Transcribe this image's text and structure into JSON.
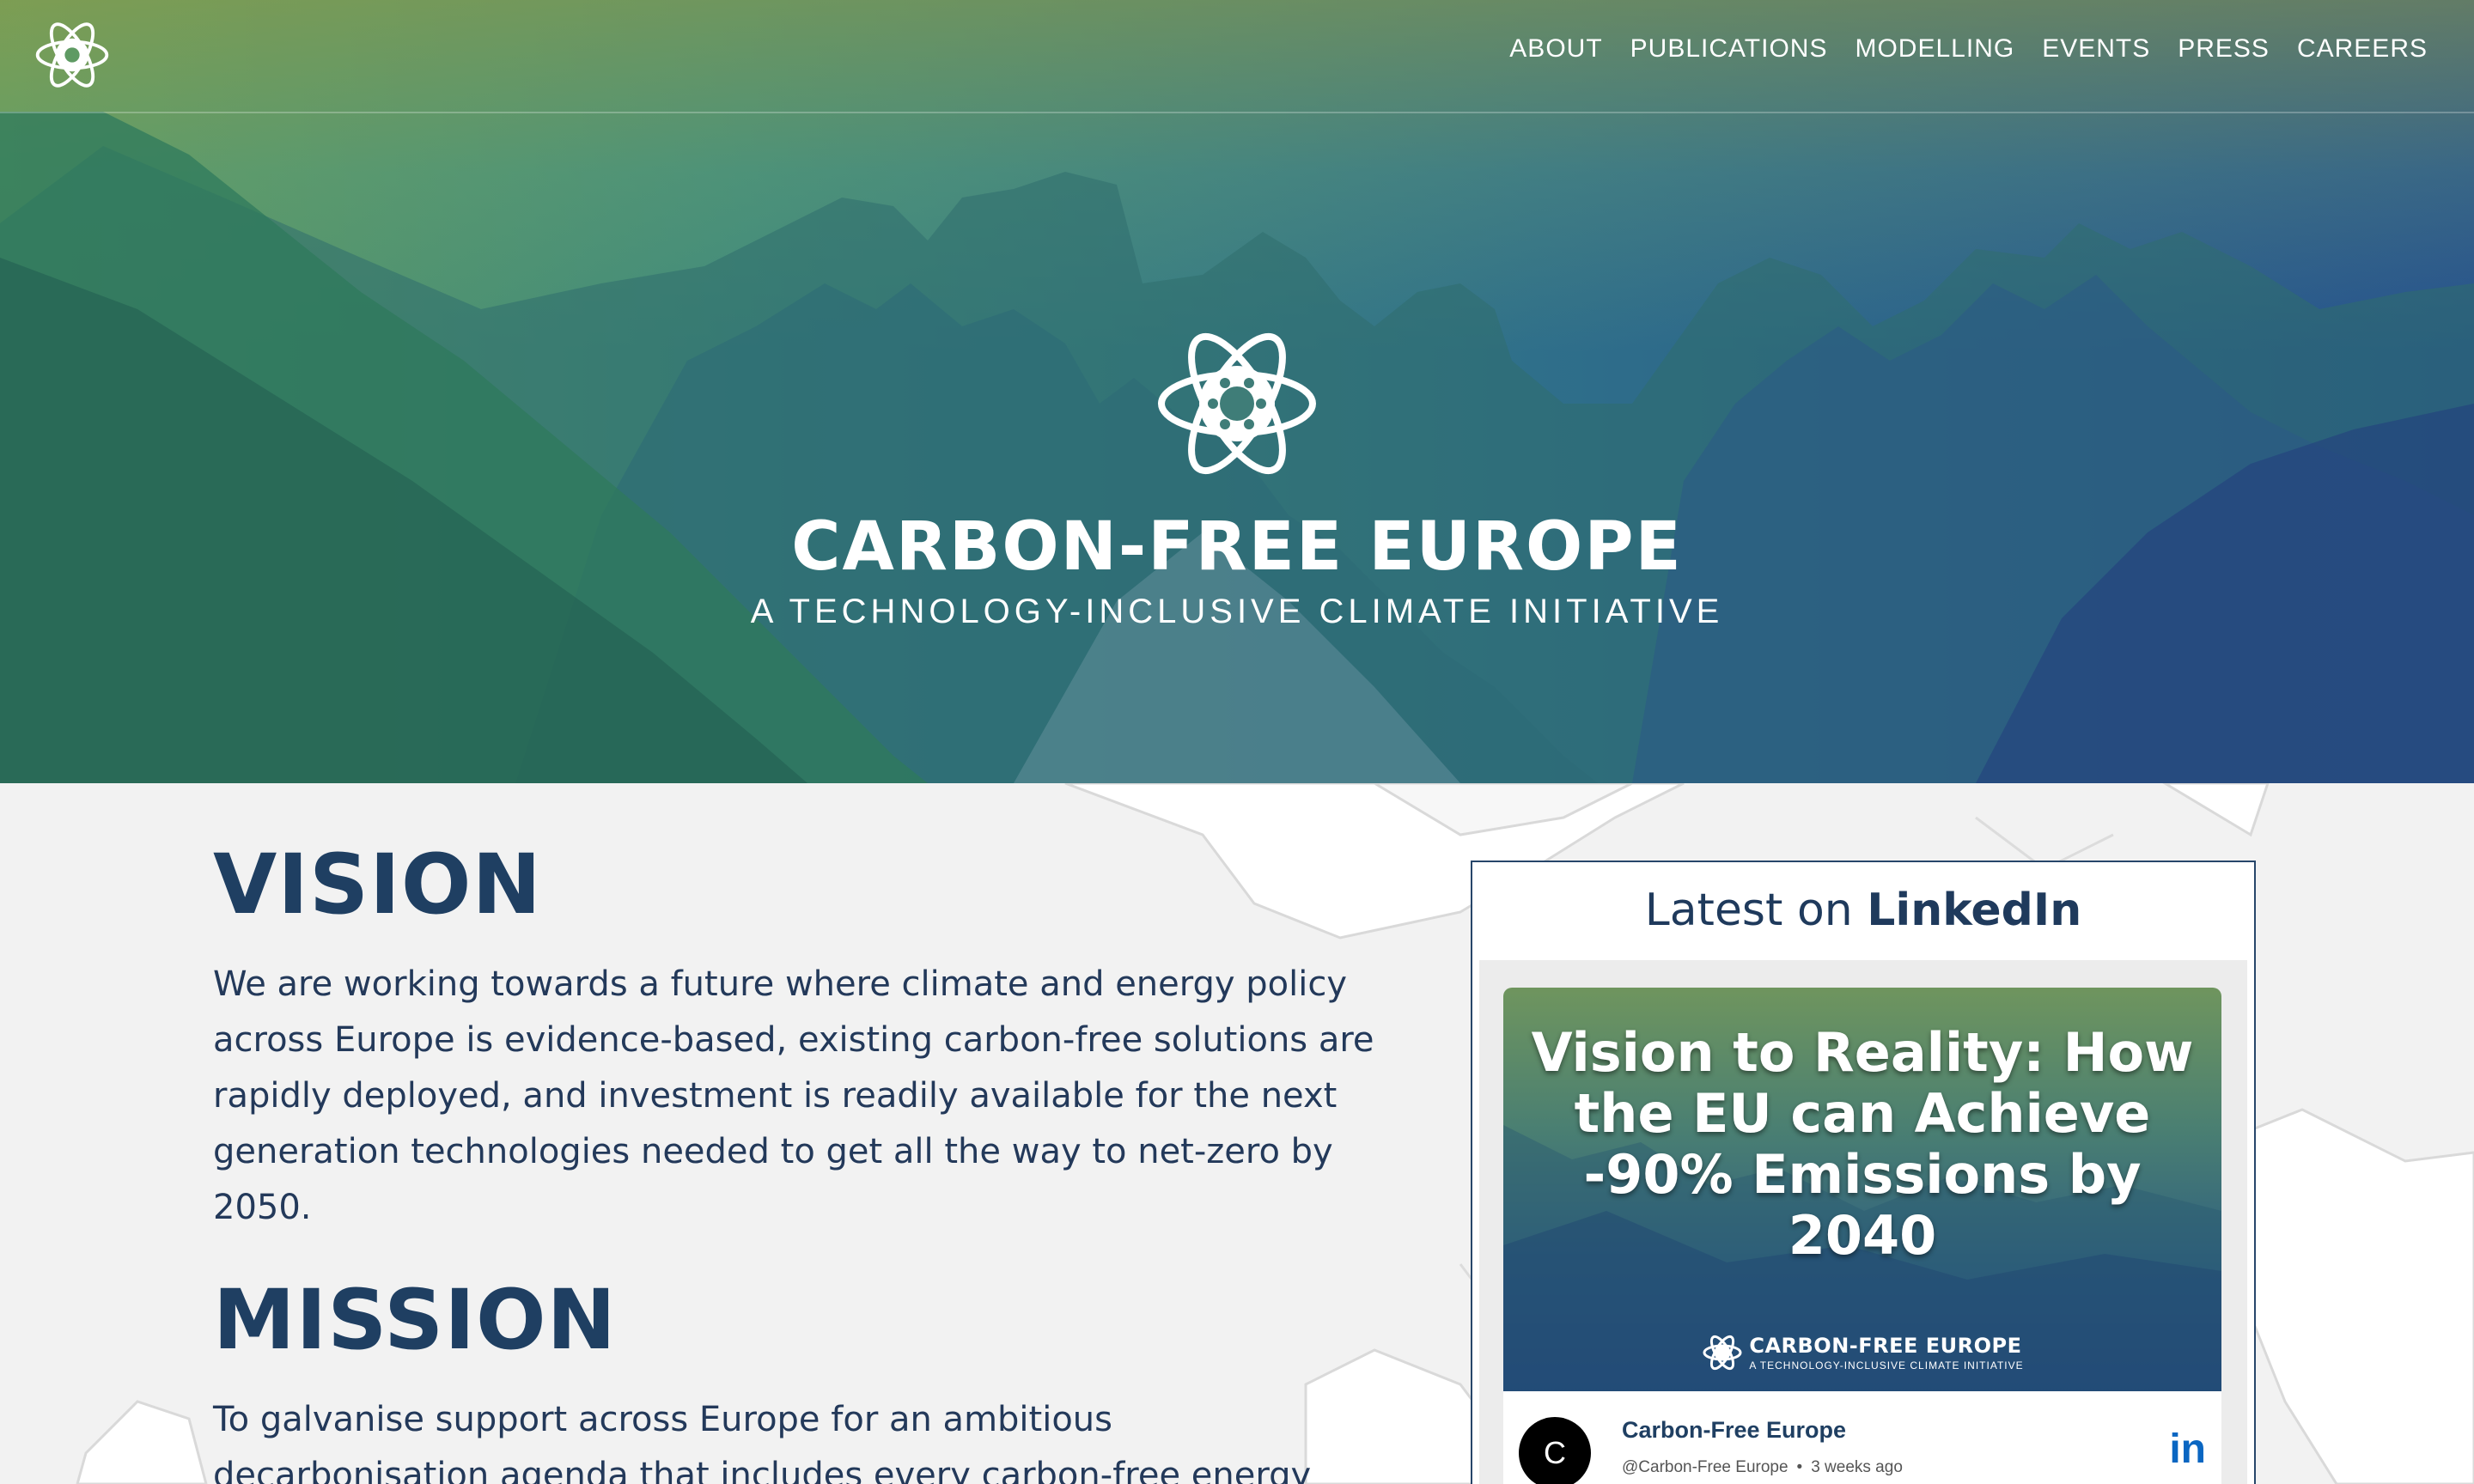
{
  "nav": {
    "items": [
      "ABOUT",
      "PUBLICATIONS",
      "MODELLING",
      "EVENTS",
      "PRESS",
      "CAREERS"
    ]
  },
  "hero": {
    "title": "CARBON-FREE EUROPE",
    "subtitle": "A TECHNOLOGY-INCLUSIVE CLIMATE INITIATIVE"
  },
  "vision": {
    "title": "VISION",
    "body": "We are working towards a future where climate and energy policy across Europe is evidence-based, existing carbon-free solutions are rapidly deployed, and investment is readily available for the next generation technologies needed to get all the way to net-zero by 2050."
  },
  "mission": {
    "title": "MISSION",
    "body": "To galvanise support across Europe for an ambitious decarbonisation agenda that includes every carbon-free energy"
  },
  "linkedin": {
    "heading_prefix": "Latest on",
    "heading_brand": "LinkedIn",
    "post": {
      "image_title": "Vision to Reality: How the EU can Achieve -90% Emissions by 2040",
      "image_brand": "CARBON-FREE EUROPE",
      "image_brand_sub": "A TECHNOLOGY-INCLUSIVE CLIMATE INITIATIVE",
      "avatar_letter": "C",
      "author": "Carbon-Free Europe",
      "handle": "@Carbon-Free Europe",
      "time": "3 weeks ago",
      "logo": "in"
    }
  },
  "colors": {
    "heading": "#1f3f62",
    "linkedin_blue": "#0a66c2",
    "hero_green": "#5e9a63",
    "hero_blue": "#24508e"
  },
  "icons": [
    "flower-star-logo-icon",
    "linkedin-icon"
  ]
}
